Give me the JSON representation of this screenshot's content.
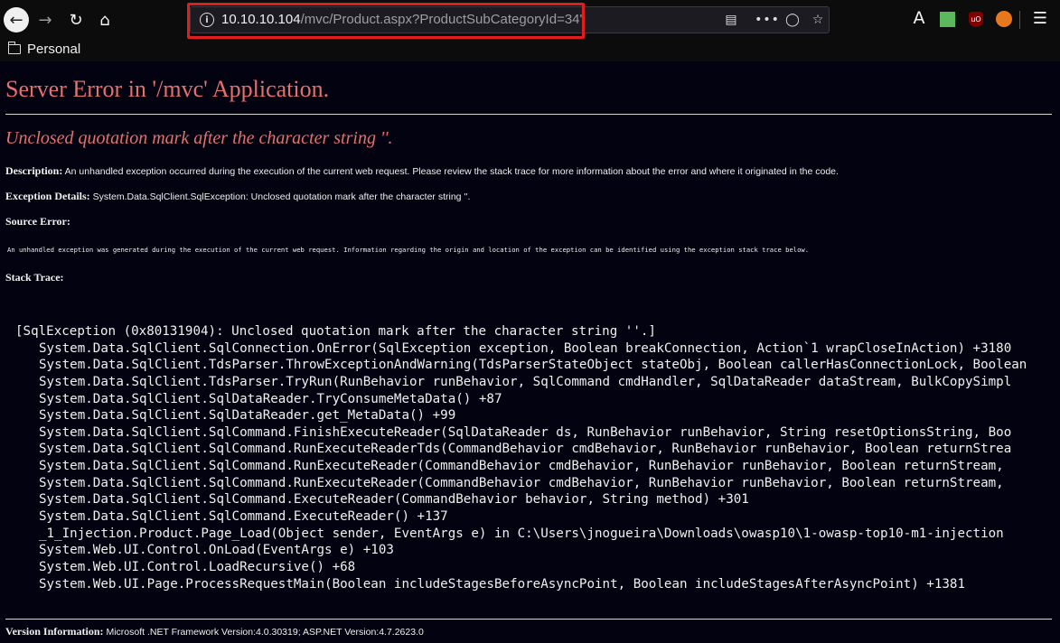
{
  "browser": {
    "url_host": "10.10.10.104",
    "url_path": "/mvc/Product.aspx?ProductSubCategoryId=34'",
    "bookmark_folder": "Personal",
    "ext_font_glyph": "A",
    "ext_ublock_glyph": "uO",
    "icons": {
      "back": "back-arrow-icon",
      "forward": "forward-arrow-icon",
      "reload": "reload-icon",
      "home": "home-icon",
      "site_info": "info-icon",
      "reader": "reader-view-icon",
      "more": "more-actions-icon",
      "pocket": "pocket-icon",
      "bookmark": "star-icon",
      "folder": "folder-icon",
      "menu": "hamburger-menu-icon"
    }
  },
  "page": {
    "title": "Server Error in '/mvc' Application.",
    "subtitle": "Unclosed quotation mark after the character string ''.",
    "description_label": "Description:",
    "description_text": " An unhandled exception occurred during the execution of the current web request. Please review the stack trace for more information about the error and where it originated in the code.",
    "exception_label": "Exception Details:",
    "exception_text": " System.Data.SqlClient.SqlException: Unclosed quotation mark after the character string ''.",
    "source_error_label": "Source Error:",
    "source_error_text": "An unhandled exception was generated during the execution of the current web request. Information regarding the origin and location of the exception can be identified using the exception stack trace below.",
    "stack_trace_label": "Stack Trace:",
    "stack_trace": [
      "[SqlException (0x80131904): Unclosed quotation mark after the character string ''.]",
      "System.Data.SqlClient.SqlConnection.OnError(SqlException exception, Boolean breakConnection, Action`1 wrapCloseInAction) +3180",
      "System.Data.SqlClient.TdsParser.ThrowExceptionAndWarning(TdsParserStateObject stateObj, Boolean callerHasConnectionLock, Boolean",
      "System.Data.SqlClient.TdsParser.TryRun(RunBehavior runBehavior, SqlCommand cmdHandler, SqlDataReader dataStream, BulkCopySimpl",
      "System.Data.SqlClient.SqlDataReader.TryConsumeMetaData() +87",
      "System.Data.SqlClient.SqlDataReader.get_MetaData() +99",
      "System.Data.SqlClient.SqlCommand.FinishExecuteReader(SqlDataReader ds, RunBehavior runBehavior, String resetOptionsString, Boo",
      "System.Data.SqlClient.SqlCommand.RunExecuteReaderTds(CommandBehavior cmdBehavior, RunBehavior runBehavior, Boolean returnStrea",
      "System.Data.SqlClient.SqlCommand.RunExecuteReader(CommandBehavior cmdBehavior, RunBehavior runBehavior, Boolean returnStream,",
      "System.Data.SqlClient.SqlCommand.RunExecuteReader(CommandBehavior cmdBehavior, RunBehavior runBehavior, Boolean returnStream,",
      "System.Data.SqlClient.SqlCommand.ExecuteReader(CommandBehavior behavior, String method) +301",
      "System.Data.SqlClient.SqlCommand.ExecuteReader() +137",
      "_1_Injection.Product.Page_Load(Object sender, EventArgs e) in C:\\Users\\jnogueira\\Downloads\\owasp10\\1-owasp-top10-m1-injection",
      "System.Web.UI.Control.OnLoad(EventArgs e) +103",
      "System.Web.UI.Control.LoadRecursive() +68",
      "System.Web.UI.Page.ProcessRequestMain(Boolean includeStagesBeforeAsyncPoint, Boolean includeStagesAfterAsyncPoint) +1381"
    ],
    "version_label": "Version Information:",
    "version_text": " Microsoft .NET Framework Version:4.0.30319; ASP.NET Version:4.7.2623.0"
  },
  "colors": {
    "page_background": "#020210",
    "error_heading": "#e47070",
    "url_highlight": "#e01e1e"
  }
}
